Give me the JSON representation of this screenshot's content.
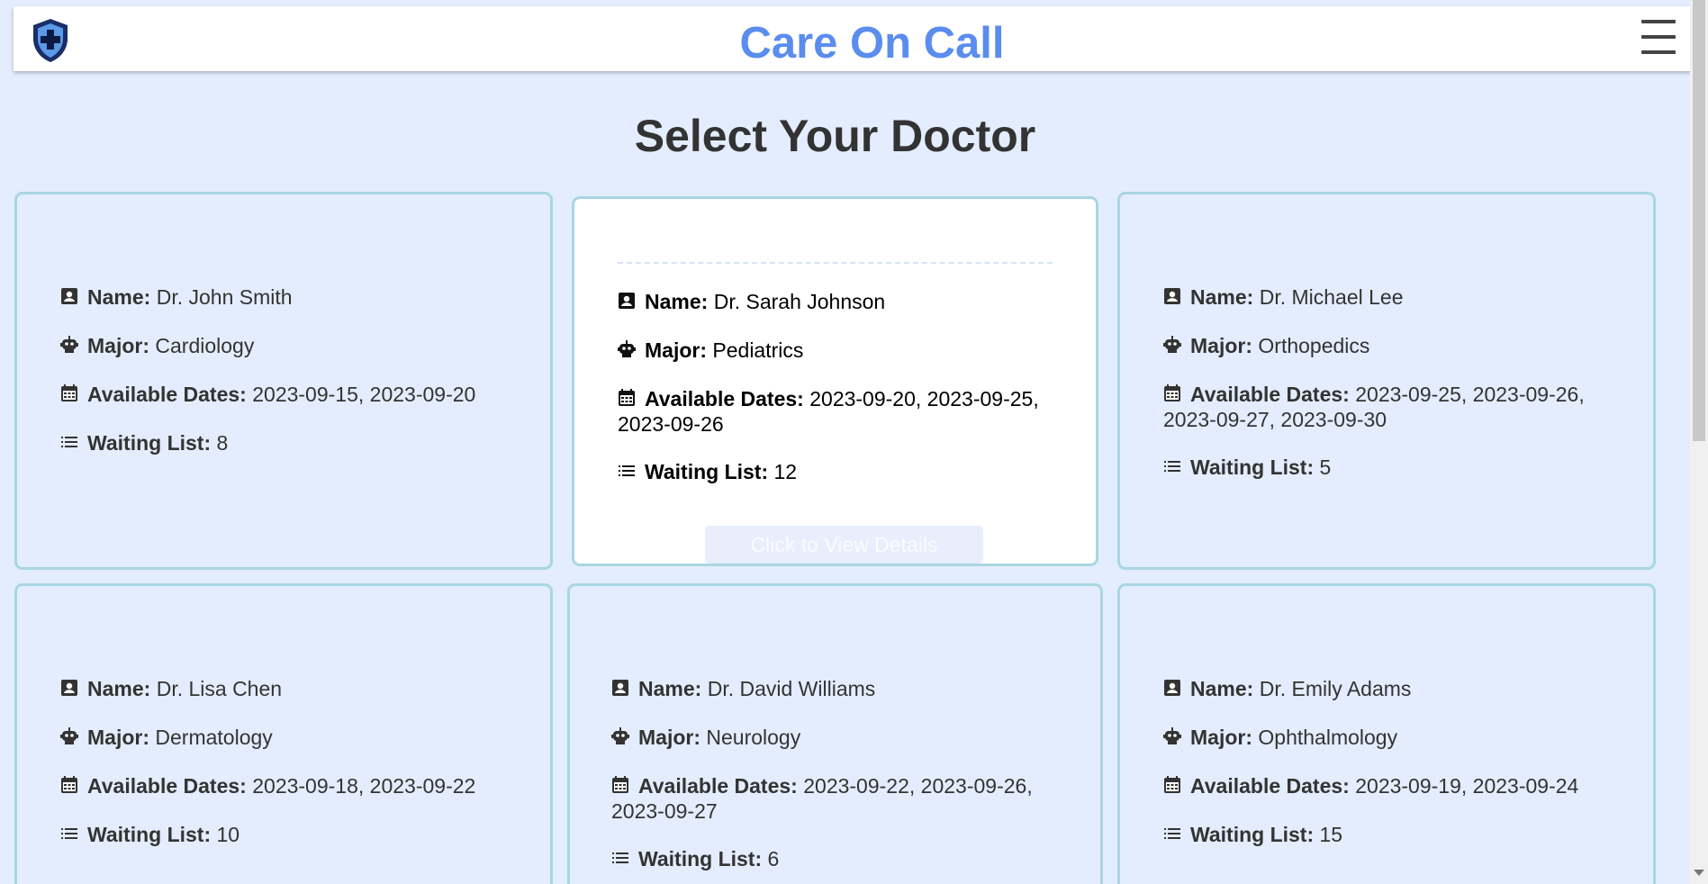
{
  "header": {
    "title": "Care On Call",
    "logo_icon": "shield-medical-icon",
    "menu_icon": "hamburger-menu-icon"
  },
  "main": {
    "heading": "Select Your Doctor"
  },
  "labels": {
    "name": "Name:",
    "major": "Major:",
    "dates": "Available Dates:",
    "waiting": "Waiting List:"
  },
  "doctors": [
    {
      "name": "Dr. John Smith",
      "major": "Cardiology",
      "dates": "2023-09-15, 2023-09-20",
      "waiting": "8"
    },
    {
      "name": "Dr. Sarah Johnson",
      "major": "Pediatrics",
      "dates": "2023-09-20, 2023-09-25, 2023-09-26",
      "waiting": "12",
      "details_button": "Click to View Details"
    },
    {
      "name": "Dr. Michael Lee",
      "major": "Orthopedics",
      "dates": "2023-09-25, 2023-09-26, 2023-09-27, 2023-09-30",
      "waiting": "5"
    },
    {
      "name": "Dr. Lisa Chen",
      "major": "Dermatology",
      "dates": "2023-09-18, 2023-09-22",
      "waiting": "10"
    },
    {
      "name": "Dr. David Williams",
      "major": "Neurology",
      "dates": "2023-09-22, 2023-09-26, 2023-09-27",
      "waiting": "6"
    },
    {
      "name": "Dr. Emily Adams",
      "major": "Ophthalmology",
      "dates": "2023-09-19, 2023-09-24",
      "waiting": "15"
    }
  ],
  "icons": {
    "name": "id-card-icon",
    "major": "robot-icon",
    "dates": "calendar-icon",
    "waiting": "list-icon"
  },
  "colors": {
    "title": "#5b8dee",
    "background": "#e3edfd",
    "card_border": "#a9d6e3"
  }
}
